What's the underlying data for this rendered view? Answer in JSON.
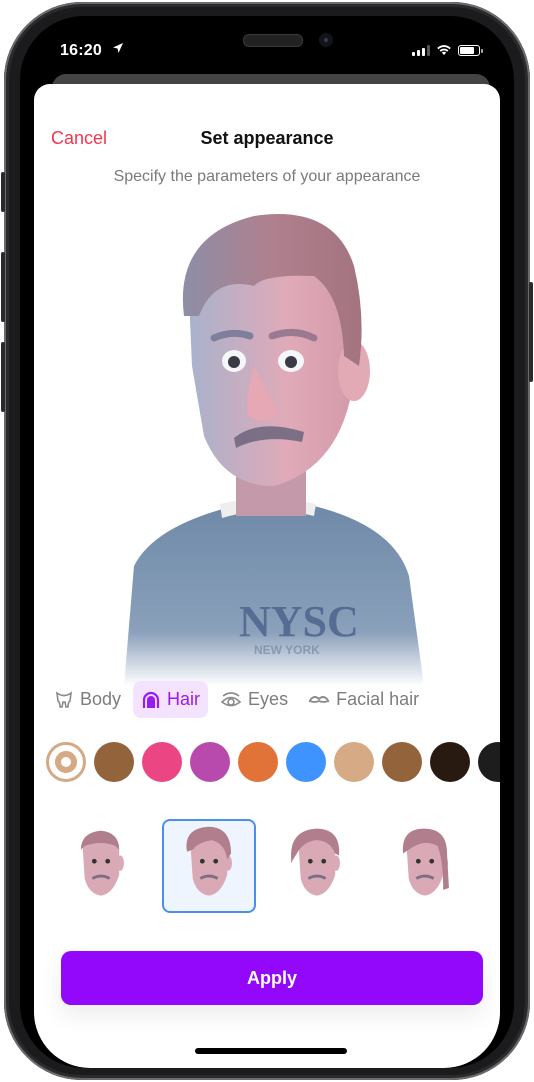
{
  "status_bar": {
    "time": "16:20",
    "location_icon": "location-arrow-icon",
    "signal_icon": "cellular-signal-icon",
    "wifi_icon": "wifi-icon",
    "battery_icon": "battery-icon"
  },
  "header": {
    "cancel_label": "Cancel",
    "title": "Set appearance",
    "subtitle": "Specify the parameters of your appearance"
  },
  "avatar": {
    "shirt_text": "NYSC",
    "shirt_subtext": "NEW YORK"
  },
  "tabs": [
    {
      "label": "Body",
      "icon": "body-icon",
      "active": false
    },
    {
      "label": "Hair",
      "icon": "hair-icon",
      "active": true
    },
    {
      "label": "Eyes",
      "icon": "eye-icon",
      "active": false
    },
    {
      "label": "Facial hair",
      "icon": "mustache-icon",
      "active": false
    }
  ],
  "colors": [
    {
      "hex": "#d4a983",
      "selected": true
    },
    {
      "hex": "#93643b"
    },
    {
      "hex": "#ec4583"
    },
    {
      "hex": "#b84aae"
    },
    {
      "hex": "#e17238"
    },
    {
      "hex": "#3f93ff"
    },
    {
      "hex": "#d5aa84"
    },
    {
      "hex": "#93643b"
    },
    {
      "hex": "#291a11"
    },
    {
      "hex": "#1d1d1d"
    }
  ],
  "hairstyles": [
    {
      "name": "short",
      "selected": false
    },
    {
      "name": "pompadour",
      "selected": true
    },
    {
      "name": "wavy",
      "selected": false
    },
    {
      "name": "long",
      "selected": false
    }
  ],
  "apply_label": "Apply",
  "theme": {
    "accent": "#9308fb",
    "cancel": "#f2364f",
    "selection_border": "#4a8ef0"
  }
}
